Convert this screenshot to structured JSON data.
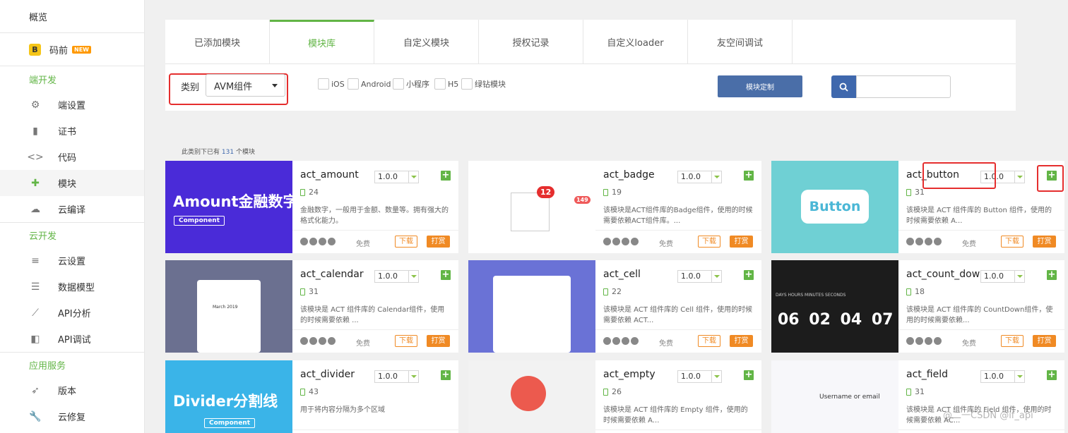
{
  "sidebar": {
    "overview": "概览",
    "maqian": {
      "label": "码前",
      "badge": "NEW"
    },
    "sections": [
      {
        "title": "端开发",
        "items": [
          {
            "label": "端设置",
            "icon": "gear-icon"
          },
          {
            "label": "证书",
            "icon": "certificate-icon"
          },
          {
            "label": "代码",
            "icon": "code-icon"
          },
          {
            "label": "模块",
            "icon": "puzzle-icon",
            "active": true
          },
          {
            "label": "云编译",
            "icon": "cloud-icon"
          }
        ]
      },
      {
        "title": "云开发",
        "items": [
          {
            "label": "云设置",
            "icon": "sliders-icon"
          },
          {
            "label": "数据模型",
            "icon": "database-icon"
          },
          {
            "label": "API分析",
            "icon": "chart-icon"
          },
          {
            "label": "API调试",
            "icon": "debug-icon"
          }
        ]
      },
      {
        "title": "应用服务",
        "items": [
          {
            "label": "版本",
            "icon": "rocket-icon"
          },
          {
            "label": "云修复",
            "icon": "wrench-icon"
          }
        ]
      }
    ]
  },
  "tabs": [
    "已添加模块",
    "模块库",
    "自定义模块",
    "授权记录",
    "自定义loader",
    "友空间调试"
  ],
  "active_tab": 1,
  "filters": {
    "category_label": "类别",
    "category_value": "AVM组件",
    "checkboxes": [
      "iOS",
      "Android",
      "小程序",
      "H5",
      "绿钻模块"
    ],
    "custom_button": "模块定制",
    "search_placeholder": ""
  },
  "count": {
    "prefix": "此类别下已有",
    "number": "131",
    "suffix": "个模块"
  },
  "common": {
    "price": "免费",
    "download": "下载",
    "tip": "打赏",
    "add": "+"
  },
  "modules": [
    {
      "name": "act_amount",
      "version": "1.0.0",
      "downloads": "24",
      "desc": "金融数字，一般用于金额、数量等。拥有强大的格式化能力。",
      "thumb_text": "Amount金融数字",
      "thumb_sub": "Component",
      "thumb_color": "#4a2bd8"
    },
    {
      "name": "act_badge",
      "version": "1.0.0",
      "downloads": "19",
      "desc": "该模块是ACT组件库的Badge组件，使用的时候需要依赖ACT组件库。...",
      "thumb_text": "12",
      "thumb_sub": "149",
      "thumb_color": "#ffffff"
    },
    {
      "name": "act_button",
      "version": "1.0.0",
      "downloads": "31",
      "desc": "该模块是 ACT 组件库的 Button 组件，使用的时候需要依赖 A...",
      "thumb_text": "Button",
      "thumb_sub": "",
      "thumb_color": "#6fd0d4"
    },
    {
      "name": "act_calendar",
      "version": "1.0.0",
      "downloads": "31",
      "desc": "该模块是 ACT 组件库的 Calendar组件，使用的时候需要依赖 ...",
      "thumb_text": "March 2019",
      "thumb_sub": "",
      "thumb_color": "#6b7090"
    },
    {
      "name": "act_cell",
      "version": "1.0.0",
      "downloads": "22",
      "desc": "该模块是 ACT 组件库的 Cell 组件，使用的时候需要依赖 ACT...",
      "thumb_text": "",
      "thumb_sub": "",
      "thumb_color": "#6a72d6"
    },
    {
      "name": "act_count_down",
      "version": "1.0.0",
      "downloads": "18",
      "desc": "该模块是 ACT 组件库的 CountDown组件，使用的时候需要依赖...",
      "thumb_text": "06 02 04 07",
      "thumb_sub": "DAYS HOURS MINUTES SECONDS",
      "thumb_color": "#1c1c1c"
    },
    {
      "name": "act_divider",
      "version": "1.0.0",
      "downloads": "43",
      "desc": "用于将内容分隔为多个区域",
      "thumb_text": "Divider分割线",
      "thumb_sub": "Component",
      "thumb_color": "#3ab4e8"
    },
    {
      "name": "act_empty",
      "version": "1.0.0",
      "downloads": "26",
      "desc": "该模块是 ACT 组件库的 Empty 组件，使用的时候需要依赖 A...",
      "thumb_text": "",
      "thumb_sub": "",
      "thumb_color": "#f2f2f2"
    },
    {
      "name": "act_field",
      "version": "1.0.0",
      "downloads": "31",
      "desc": "该模块是 ACT 组件库的 Field 组件，使用的时候需要依赖 AC...",
      "thumb_text": "Username or email",
      "thumb_sub": "",
      "thumb_color": "#f7f7fa"
    }
  ],
  "watermark": "@二一CSDN @if_api"
}
